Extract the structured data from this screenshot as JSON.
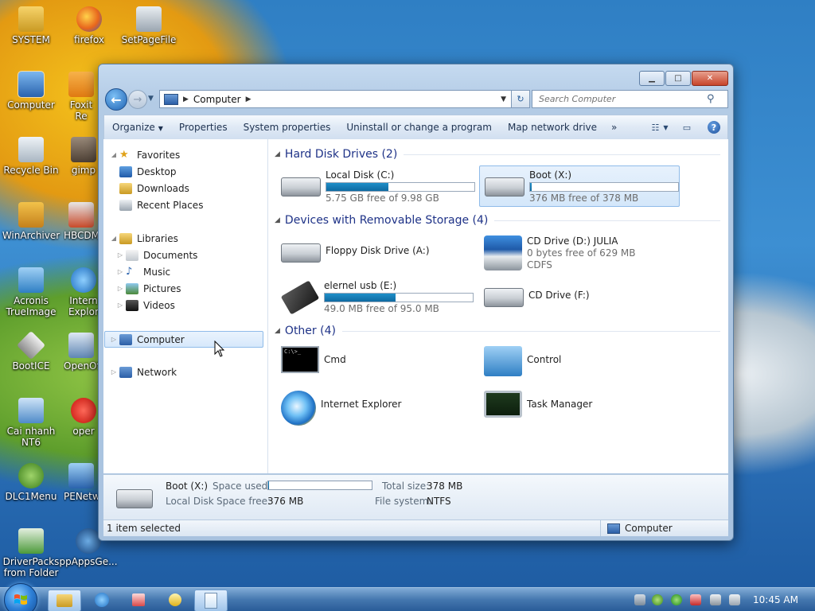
{
  "desktop": {
    "icons": [
      {
        "label": "SYSTEM",
        "icon": "folder-user-icon"
      },
      {
        "label": "firefox",
        "icon": "firefox-icon"
      },
      {
        "label": "SetPageFile",
        "icon": "setpagefile-icon"
      },
      {
        "label": "Computer",
        "icon": "computer-icon"
      },
      {
        "label": "Foxit Re",
        "icon": "pdf-icon"
      },
      {
        "label": "Recycle Bin",
        "icon": "recycle-bin-icon"
      },
      {
        "label": "gimp",
        "icon": "gimp-icon"
      },
      {
        "label": "WinArchiver",
        "icon": "archiver-icon"
      },
      {
        "label": "HBCDM",
        "icon": "tools-icon"
      },
      {
        "label": "Acronis TrueImage",
        "icon": "acronis-icon"
      },
      {
        "label": "Intern Explore",
        "icon": "ie-icon"
      },
      {
        "label": "BootICE",
        "icon": "bootice-icon"
      },
      {
        "label": "OpenOf",
        "icon": "openoffice-icon"
      },
      {
        "label": "Cai nhanh NT6",
        "icon": "install-icon"
      },
      {
        "label": "oper",
        "icon": "opera-icon"
      },
      {
        "label": "DLC1Menu",
        "icon": "dlc-icon"
      },
      {
        "label": "PENetw",
        "icon": "network-icon"
      },
      {
        "label": "DriverPacks from Folder",
        "icon": "driverpack-icon"
      },
      {
        "label": "ppAppsGe...",
        "icon": "apps-icon"
      }
    ]
  },
  "window": {
    "address": {
      "crumb": "Computer"
    },
    "search": {
      "placeholder": "Search Computer"
    },
    "toolbar": {
      "organize": "Organize",
      "properties": "Properties",
      "system_properties": "System properties",
      "uninstall": "Uninstall or change a program",
      "map_drive": "Map network drive",
      "more": "»"
    },
    "nav": {
      "favorites": "Favorites",
      "desktop": "Desktop",
      "downloads": "Downloads",
      "recent": "Recent Places",
      "libraries": "Libraries",
      "documents": "Documents",
      "music": "Music",
      "pictures": "Pictures",
      "videos": "Videos",
      "computer": "Computer",
      "network": "Network"
    },
    "groups": {
      "hdd": "Hard Disk Drives (2)",
      "removable": "Devices with Removable Storage (4)",
      "other": "Other (4)"
    },
    "drives": {
      "local_c": {
        "name": "Local Disk (C:)",
        "info": "5.75 GB free of 9.98 GB",
        "used_fraction": 0.42
      },
      "boot_x": {
        "name": "Boot (X:)",
        "info": "376 MB free of 378 MB",
        "used_fraction": 0.01
      },
      "floppy": {
        "name": "Floppy Disk Drive (A:)"
      },
      "cd_d": {
        "name": "CD Drive (D:) JULIA",
        "info": "0 bytes free of 629 MB",
        "fs": "CDFS"
      },
      "usb_e": {
        "name": "elernel usb (E:)",
        "info": "49.0 MB free of 95.0 MB",
        "used_fraction": 0.48
      },
      "cd_f": {
        "name": "CD Drive (F:)"
      }
    },
    "other": {
      "cmd": "Cmd",
      "control": "Control",
      "ie": "Internet Explorer",
      "taskmgr": "Task Manager"
    },
    "details": {
      "name": "Boot (X:)",
      "type": "Local Disk",
      "space_used_label": "Space used:",
      "space_free_label": "Space free:",
      "space_free": "376 MB",
      "total_size_label": "Total size:",
      "total_size": "378 MB",
      "fs_label": "File system:",
      "fs": "NTFS",
      "used_fraction": 0.01
    },
    "status": {
      "left": "1 item selected",
      "right": "Computer"
    }
  },
  "taskbar": {
    "clock": "10:45 AM"
  },
  "colors": {
    "accent": "#1e3287",
    "selection": "#d6e8fb",
    "bar_fill": "#0f6aa1"
  }
}
